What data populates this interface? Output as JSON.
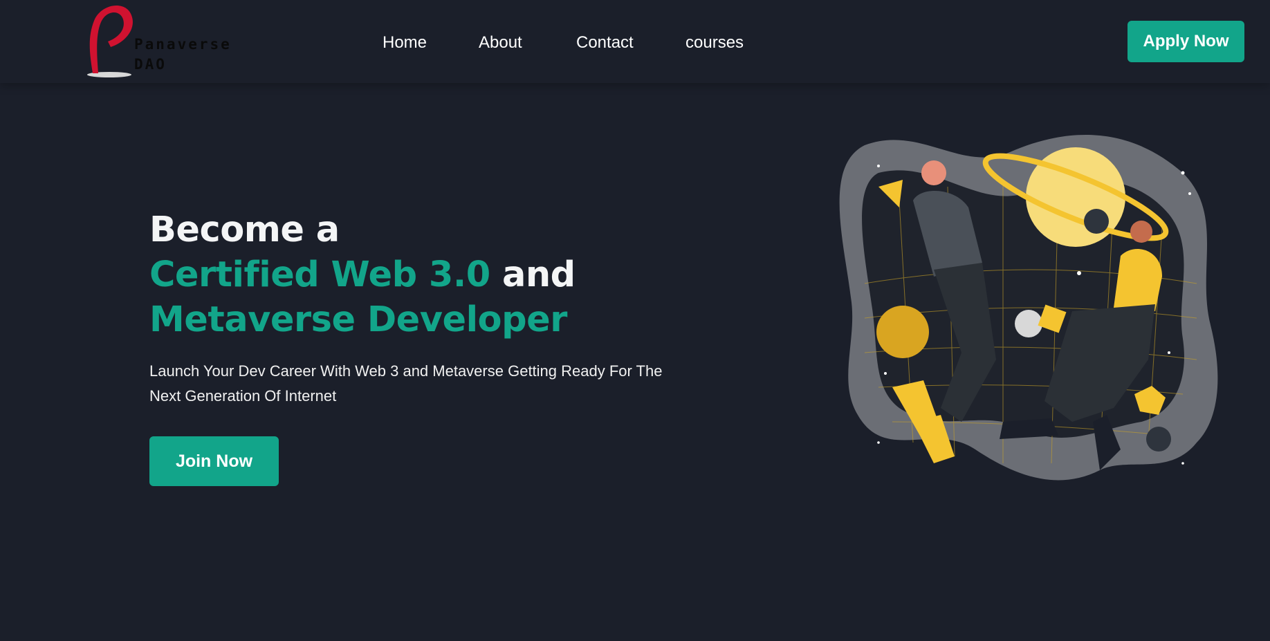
{
  "brand": {
    "name_line1": "Panaverse",
    "name_line2": "DAO",
    "logo_color": "#d01230"
  },
  "nav": {
    "items": [
      {
        "label": "Home"
      },
      {
        "label": "About"
      },
      {
        "label": "Contact"
      },
      {
        "label": "courses"
      }
    ]
  },
  "header_actions": {
    "notification_icon": "bell-icon",
    "theme_icon": "sun-icon",
    "apply_label": "Apply Now"
  },
  "hero": {
    "line1": "Become a",
    "line2_accent": "Certified Web 3.0",
    "line2_rest": " and",
    "line3_accent": "Metaverse Developer",
    "subtitle": "Launch Your Dev Career With Web 3 and Metaverse Getting Ready For The Next Generation Of Internet",
    "cta_label": "Join Now",
    "illustration": "metaverse-vr-people-illustration"
  },
  "colors": {
    "background": "#1b1f2a",
    "accent": "#12a58a",
    "text": "#ffffff"
  }
}
